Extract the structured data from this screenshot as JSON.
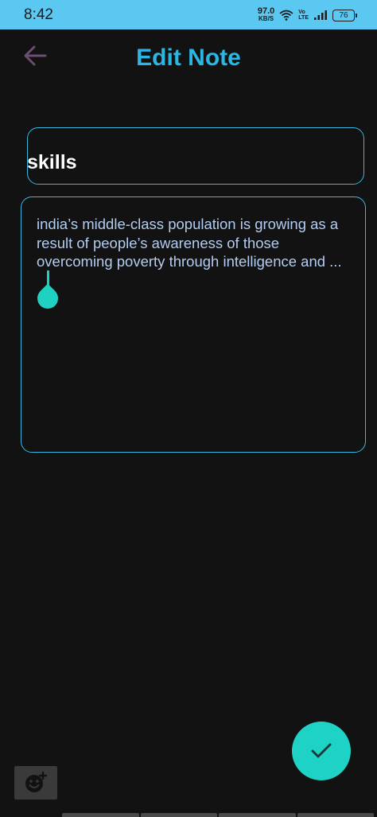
{
  "status_bar": {
    "time": "8:42",
    "net_speed_value": "97.0",
    "net_speed_unit": "KB/S",
    "volte_top": "Vo",
    "volte_bottom": "LTE",
    "battery": "76"
  },
  "header": {
    "title": "Edit Note",
    "back_icon": "arrow-left-icon"
  },
  "note": {
    "title": "skills",
    "body": "india’s middle-class population is growing as a result of people’s awareness of those overcoming poverty through intelligence and ..."
  },
  "actions": {
    "save_icon": "checkmark-icon",
    "sticker_icon": "add-emoji-icon"
  },
  "colors": {
    "accent": "#2ab7e3",
    "fab": "#1ed3c6",
    "background": "#121212",
    "status_bar": "#5bc8f2"
  }
}
